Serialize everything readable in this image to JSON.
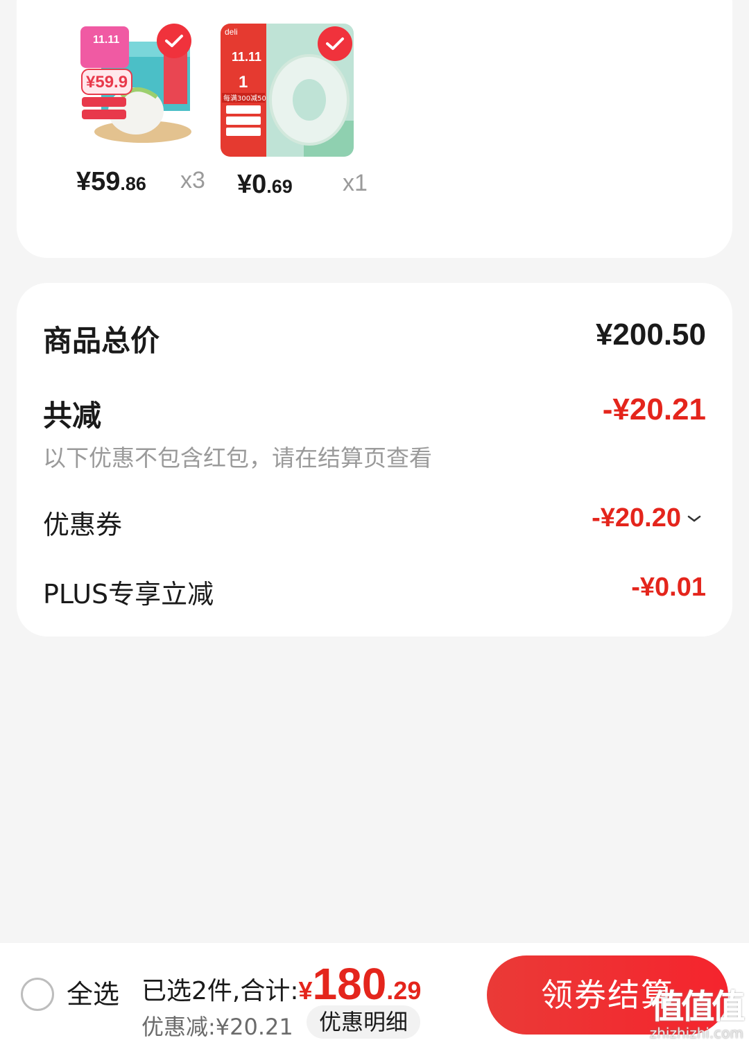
{
  "products": [
    {
      "name": "product-1",
      "price_int": "¥59",
      "price_dec": ".86",
      "qty": "x3",
      "badge_text": "11.11",
      "tag_price": "¥59.9"
    },
    {
      "name": "product-2",
      "price_int": "¥0",
      "price_dec": ".69",
      "qty": "x1",
      "badge_text": "11.11",
      "brand": "deli",
      "promo": "每满300减50"
    }
  ],
  "summary": {
    "total_label": "商品总价",
    "total_value": "¥200.50",
    "reduce_label": "共减",
    "reduce_value": "-¥20.21",
    "note": "以下优惠不包含红包，请在结算页查看",
    "coupon_label": "优惠券",
    "coupon_value": "-¥20.20",
    "plus_label": "PLUS专享立减",
    "plus_value": "-¥0.01"
  },
  "bottom": {
    "select_all": "全选",
    "selected_text": "已选2件,合计:",
    "currency": "¥",
    "total_int": "180",
    "total_dec": ".29",
    "saved_text": "优惠减:¥20.21",
    "detail_button": "优惠明细",
    "checkout_button": "领券结算"
  },
  "watermark": {
    "logo": "值值值",
    "url": "zhizhizhi.com"
  },
  "colors": {
    "accent_red": "#e4251c",
    "background": "#f5f5f5",
    "card": "#ffffff"
  }
}
